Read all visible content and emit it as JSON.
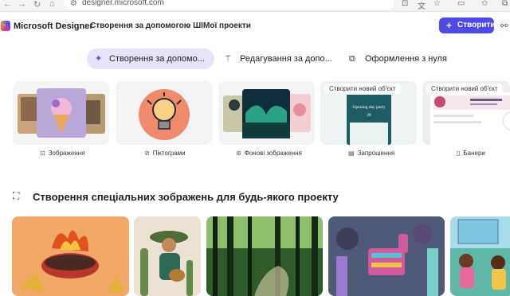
{
  "browser": {
    "url": "designer.microsoft.com",
    "back_icon": "arrow-left",
    "forward_icon": "arrow-right",
    "refresh_icon": "refresh",
    "home_icon": "home"
  },
  "header": {
    "brand": "Microsoft Designer",
    "menu_create": "Створення за допомогою ШІ",
    "menu_projects": "Мої проекти",
    "create_button": "Створити",
    "accent_color": "#4f4ae6"
  },
  "tabs": [
    {
      "label": "Створення за допомо...",
      "icon": "sparkle-icon",
      "active": true
    },
    {
      "label": "Редагування за допо...",
      "icon": "wand-icon",
      "active": false
    },
    {
      "label": "Оформлення з нуля",
      "icon": "layout-icon",
      "active": false
    }
  ],
  "categories": [
    {
      "label": "Зображення",
      "icon": "image-icon"
    },
    {
      "label": "Піктограми",
      "icon": "sticker-icon"
    },
    {
      "label": "Фонові зображення",
      "icon": "background-icon"
    },
    {
      "label": "Запрошення",
      "icon": "invitation-icon",
      "pill": "Створити новий об'єкт",
      "preview_title": "Opening day party",
      "preview_date": "29"
    },
    {
      "label": "Банери",
      "icon": "banner-icon",
      "pill": "Створити новий об'єкт"
    }
  ],
  "section": {
    "title": "Створення спеціальних зображень для будь-якого проекту",
    "icon": "image-sparkle-icon"
  }
}
